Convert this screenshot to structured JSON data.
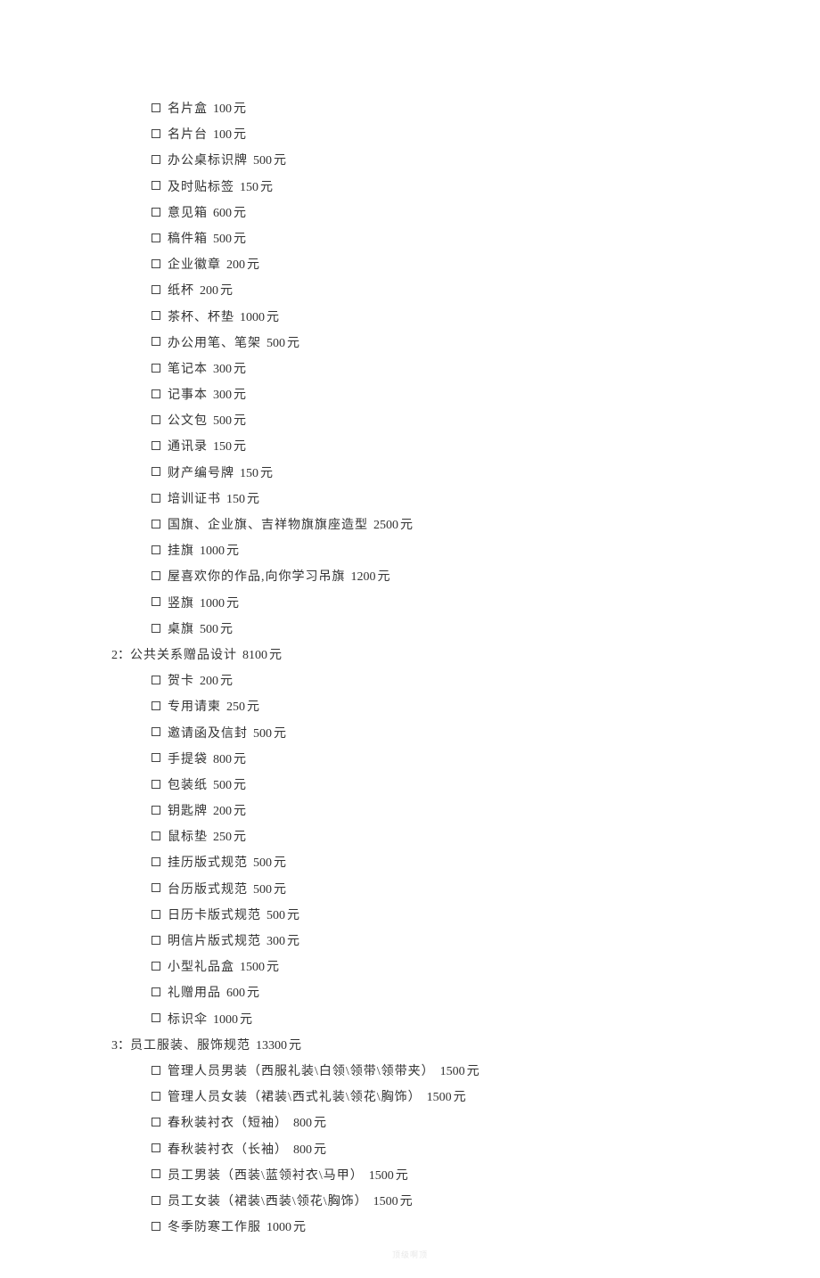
{
  "unit": "元",
  "sections": [
    {
      "header": null,
      "items": [
        {
          "label": "名片盒",
          "price": "100"
        },
        {
          "label": "名片台",
          "price": "100"
        },
        {
          "label": "办公桌标识牌",
          "price": "500"
        },
        {
          "label": "及时贴标签",
          "price": "150"
        },
        {
          "label": "意见箱",
          "price": "600"
        },
        {
          "label": "稿件箱",
          "price": "500"
        },
        {
          "label": "企业徽章",
          "price": "200"
        },
        {
          "label": "纸杯",
          "price": "200"
        },
        {
          "label": "茶杯、杯垫",
          "price": "1000"
        },
        {
          "label": "办公用笔、笔架",
          "price": "500"
        },
        {
          "label": "笔记本",
          "price": "300"
        },
        {
          "label": "记事本",
          "price": "300"
        },
        {
          "label": "公文包",
          "price": "500"
        },
        {
          "label": "通讯录",
          "price": "150"
        },
        {
          "label": "财产编号牌",
          "price": "150"
        },
        {
          "label": "培训证书",
          "price": "150"
        },
        {
          "label": "国旗、企业旗、吉祥物旗旗座造型",
          "price": "2500"
        },
        {
          "label": "挂旗",
          "price": "1000"
        },
        {
          "label": "屋喜欢你的作品,向你学习吊旗",
          "price": "1200"
        },
        {
          "label": "竖旗",
          "price": "1000"
        },
        {
          "label": "桌旗",
          "price": "500"
        }
      ]
    },
    {
      "header": {
        "prefix": "2：",
        "title": "公共关系赠品设计",
        "price": "8100"
      },
      "items": [
        {
          "label": "贺卡",
          "price": "200"
        },
        {
          "label": "专用请柬",
          "price": "250"
        },
        {
          "label": "邀请函及信封",
          "price": "500"
        },
        {
          "label": "手提袋",
          "price": "800"
        },
        {
          "label": "包装纸",
          "price": "500"
        },
        {
          "label": "钥匙牌",
          "price": "200"
        },
        {
          "label": "鼠标垫",
          "price": "250"
        },
        {
          "label": "挂历版式规范",
          "price": "500"
        },
        {
          "label": "台历版式规范",
          "price": "500"
        },
        {
          "label": "日历卡版式规范",
          "price": "500"
        },
        {
          "label": "明信片版式规范",
          "price": "300"
        },
        {
          "label": "小型礼品盒",
          "price": "1500"
        },
        {
          "label": "礼赠用品",
          "price": "600"
        },
        {
          "label": "标识伞",
          "price": "1000"
        }
      ]
    },
    {
      "header": {
        "prefix": "3：",
        "title": "员工服装、服饰规范",
        "price": "13300"
      },
      "items": [
        {
          "label": "管理人员男装（西服礼装\\白领\\领带\\领带夹）",
          "price": "1500"
        },
        {
          "label": "管理人员女装（裙装\\西式礼装\\领花\\胸饰）",
          "price": "1500"
        },
        {
          "label": "春秋装衬衣（短袖）",
          "price": "800"
        },
        {
          "label": "春秋装衬衣（长袖）",
          "price": "800"
        },
        {
          "label": "员工男装（西装\\蓝领衬衣\\马甲）",
          "price": "1500"
        },
        {
          "label": "员工女装（裙装\\西装\\领花\\胸饰）",
          "price": "1500"
        },
        {
          "label": "冬季防寒工作服",
          "price": "1000"
        }
      ]
    }
  ],
  "footer": "顶级啊顶"
}
